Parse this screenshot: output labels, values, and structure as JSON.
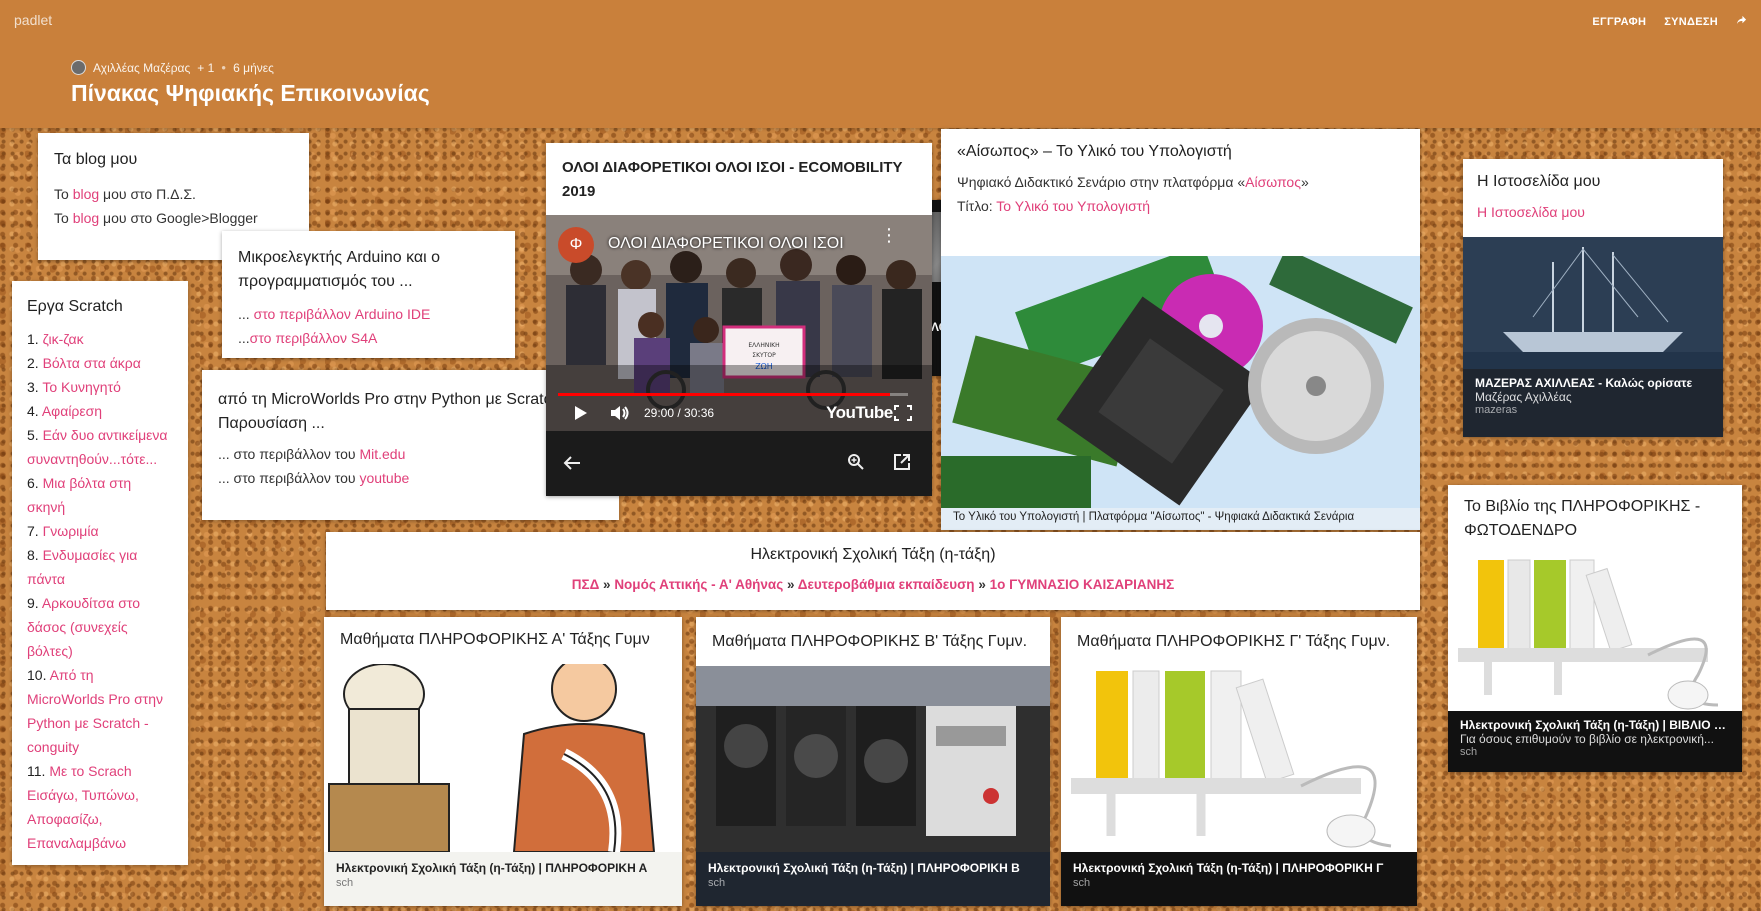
{
  "header": {
    "logo": "padlet",
    "signup": "ΕΓΓΡΑΦΗ",
    "login": "ΣΥΝΔΕΣΗ",
    "share_icon": "share-icon",
    "author": "Αχιλλέας Μαζέρας",
    "likes": "+ 1",
    "age": "6 μήνες",
    "title": "Πίνακας Ψηφιακής Επικοινωνίας"
  },
  "blogs": {
    "title": "Τα blog μου",
    "line1_pre": "Το ",
    "line1_link": "blog",
    "line1_post": " μου στο Π.Δ.Σ.",
    "line2_pre": "Το ",
    "line2_link": "blog",
    "line2_post": " μου στο Google>Blogger"
  },
  "scratch": {
    "title": "Εργα Scratch",
    "items": [
      {
        "num": "1.",
        "text": "ζικ-ζακ"
      },
      {
        "num": "2.",
        "text": "Βόλτα στα άκρα"
      },
      {
        "num": "3.",
        "text": "Το Κυνηγητό"
      },
      {
        "num": "4.",
        "text": "Αφαίρεση"
      },
      {
        "num": "5.",
        "text": "Εάν δυο αντικείμενα συναντηθούν...τότε..."
      },
      {
        "num": "6.",
        "text": "Μια βόλτα στη σκηνή"
      },
      {
        "num": "7.",
        "text": "Γνωριμία"
      },
      {
        "num": "8.",
        "text": "Ενδυμασίες για πάντα"
      },
      {
        "num": "9.",
        "text": "Αρκουδίτσα στο δάσος (συνεχείς βόλτες)"
      },
      {
        "num": "10.",
        "text": "Από τη MicroWorlds Pro στην Python με Scratch - conguity"
      },
      {
        "num": "11.",
        "text": "Με το Scrach Εισάγω, Τυπώνω, Αποφασίζω, Επαναλαμβάνω"
      }
    ]
  },
  "arduino": {
    "title": "Μικροελεγκτής Arduino και ο προγραμματισμός του ...",
    "line1_pre": "... ",
    "line1_link": "στο περιβάλλον Arduino IDE",
    "line2_pre": "...",
    "line2_link": "στο περιβάλλον S4A"
  },
  "microworlds": {
    "title": "από τη MicroWorlds Pro στην Python με Scratch Παρουσίαση ...",
    "line1_pre": "... στο περιβάλλον του ",
    "line1_link": "Mit.edu",
    "line2_pre": "... στο περιβάλλον του ",
    "line2_link": "youtube"
  },
  "video": {
    "title": "ΟΛΟΙ ΔΙΑΦΟΡΕΤΙΚΟΙ ΟΛΟΙ ΙΣΟΙ - ECOMOBILITY 2019",
    "player_title": "ΟΛΟΙ ΔΙΑΦΟΡΕΤΙΚΟΙ ΟΛΟΙ ΙΣΟΙ",
    "channel_letter": "Φ",
    "time": "29:00 / 30:36",
    "progress": 0.948,
    "youtube_label": "YouTube",
    "behind_title": "ΛΟΙ ΙΣΟΙ",
    "sign_text": "ΕΛΛΗΝΙΚΗ ΣΚΥΤΟΡ ΖΩΗ"
  },
  "aisopos": {
    "title": "«Αίσωπος» – Το Υλικό του Υπολογιστή",
    "line1_pre": "Ψηφιακό Διδακτικό Σενάριο στην πλατφόρμα «",
    "line1_link": "Αίσωπος",
    "line1_post": "»",
    "line2_pre": "Τίτλο: ",
    "line2_link": "Το Υλικό του Υπολογιστή",
    "caption": "Το Υλικό του Υπολογιστή | Πλατφόρμα \"Αίσωπος\" - Ψηφιακά Διδακτικά Σενάρια"
  },
  "website": {
    "title": "Η Ιστοσελίδα μου",
    "link": "Η Ιστοσελίδα μου",
    "cap_title": "ΜΑΖΕΡΑΣ ΑΧΙΛΛΕΑΣ - Καλώς ορίσατε",
    "cap_sub": "Μαζέρας Αχιλλέας",
    "cap_domain": "mazeras"
  },
  "book": {
    "title": "Το Βιβλίο της ΠΛΗΡΟΦΟΡΙΚΗΣ - ΦΩΤΟΔΕΝΔΡΟ",
    "cap_title": "Ηλεκτρονική Σχολική Τάξη (η-Τάξη) | ΒΙΒΛΙΟ Π...",
    "cap_sub": "Για όσους επιθυμούν το βιβλίο σε ηλεκτρονική...",
    "cap_domain": "sch"
  },
  "eclass": {
    "title": "Ηλεκτρονική Σχολική Τάξη (η-τάξη)",
    "crumb1": "ΠΣΔ",
    "crumb2": "Νομός Αττικής - Α' Αθήνας",
    "crumb3": "Δευτεροβάθμια εκπαίδευση",
    "crumb4": "1ο ΓΥΜΝΑΣΙΟ ΚΑΙΣΑΡΙΑΝΗΣ",
    "sep": " » "
  },
  "classA": {
    "title": "Μαθήματα ΠΛΗΡΟΦΟΡΙΚΗΣ Α' Τάξης Γυμν",
    "cap_title": "Ηλεκτρονική Σχολική Τάξη (η-Τάξη) | ΠΛΗΡΟΦΟΡΙΚΗ Α",
    "cap_domain": "sch"
  },
  "classB": {
    "title": "Μαθήματα ΠΛΗΡΟΦΟΡΙΚΗΣ Β' Τάξης Γυμν.",
    "cap_title": "Ηλεκτρονική Σχολική Τάξη (η-Τάξη) | ΠΛΗΡΟΦΟΡΙΚΗ Β",
    "cap_domain": "sch"
  },
  "classC": {
    "title": "Μαθήματα ΠΛΗΡΟΦΟΡΙΚΗΣ Γ' Τάξης Γυμν.",
    "cap_title": "Ηλεκτρονική Σχολική Τάξη (η-Τάξη) | ΠΛΗΡΟΦΟΡΙΚΗ Γ",
    "cap_domain": "sch"
  },
  "colors": {
    "header": "#c9803b",
    "link": "#e0407a",
    "caption_bg": "#1f2630"
  }
}
